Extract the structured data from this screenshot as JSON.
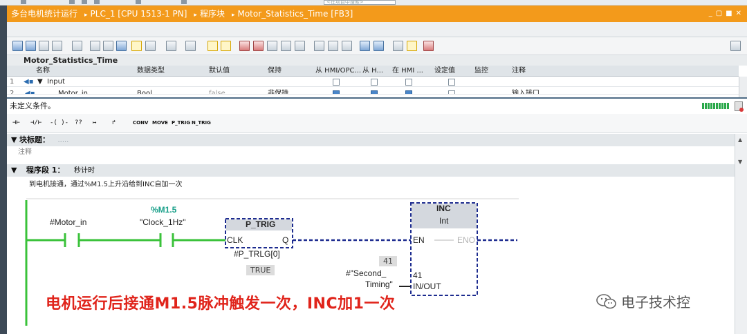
{
  "topbar": {
    "search_placeholder": "<在项目中搜索>"
  },
  "titlebar": {
    "crumbs": [
      "多台电机统计运行",
      "PLC_1 [CPU 1513-1 PN]",
      "程序块",
      "Motor_Statistics_Time [FB3]"
    ],
    "separator": "▸",
    "window_buttons": [
      "_",
      "▢",
      "■",
      "✕"
    ]
  },
  "block_name": "Motor_Statistics_Time",
  "interface": {
    "headers": [
      "名称",
      "数据类型",
      "默认值",
      "保持",
      "从 HMI/OPC...",
      "从 H...",
      "在 HMI ...",
      "设定值",
      "监控",
      "注释"
    ],
    "rows": [
      {
        "num": "1",
        "name": "Input",
        "type": "",
        "default": "",
        "retain": "",
        "comment": ""
      },
      {
        "num": "2",
        "name": "Motor_in",
        "type": "Bool",
        "default": "false",
        "retain": "非保持",
        "comment": "输入接口"
      }
    ]
  },
  "status": {
    "text": "未定义条件。"
  },
  "lad_palette": {
    "symbols": [
      "⊣⊢",
      "⊣/⊢",
      "-( )-",
      "??",
      "↦",
      "↱"
    ],
    "texts": [
      "CONV",
      "MOVE",
      "P_TRIG",
      "N_TRIG"
    ]
  },
  "block_title": {
    "label": "块标题：",
    "placeholder": "....."
  },
  "block_comment": "注释",
  "network": {
    "label": "程序段 1：",
    "title": "秒计时",
    "comment": "到电机接通，通过%M1.5上升沿给到INC自加一次"
  },
  "ladder": {
    "contact1": {
      "name": "#Motor_in"
    },
    "contact2": {
      "address": "%M1.5",
      "name": "\"Clock_1Hz\""
    },
    "ptrig": {
      "title": "P_TRIG",
      "clk": "CLK",
      "q": "Q",
      "instance": "#P_TRLG[0]",
      "value": "TRUE"
    },
    "inc": {
      "title": "INC",
      "type": "Int",
      "en": "EN",
      "eno": "ENO",
      "inout": "IN/OUT",
      "inout_value": "41",
      "ext_value": "41",
      "var_line1": "#\"Second_",
      "var_line2": "Timing\""
    }
  },
  "caption": "电机运行后接通M1.5脉冲触发一次，INC加1一次",
  "watermark": {
    "text": "电子技术控"
  },
  "colors": {
    "title_orange": "#f39a1b",
    "power_green": "#3ac23a",
    "signal_navy": "#1d2c8f",
    "caption_red": "#e0241b",
    "param_teal": "#1aa08a"
  }
}
